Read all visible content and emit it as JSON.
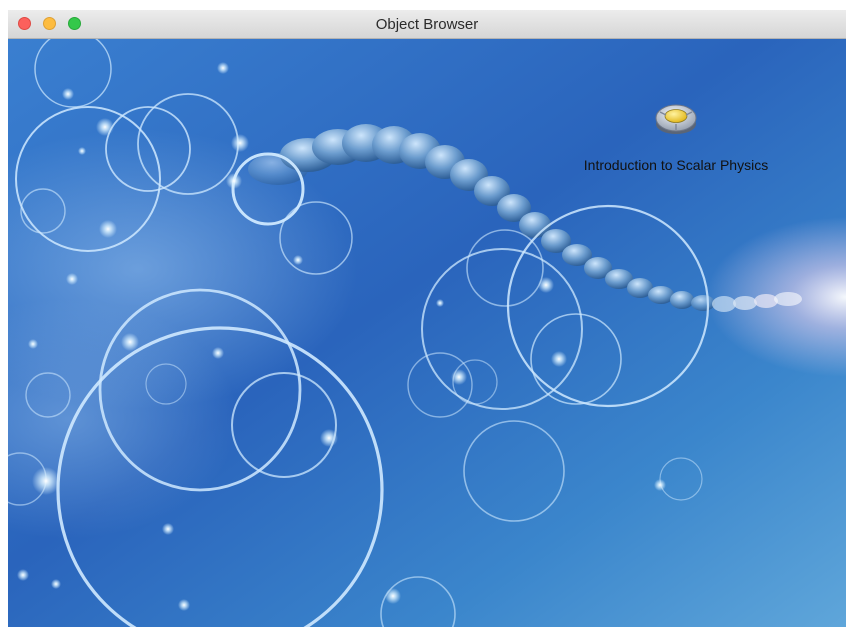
{
  "window": {
    "title": "Object Browser",
    "controls": [
      "close",
      "minimize",
      "zoom"
    ]
  },
  "desktop": {
    "items": [
      {
        "label": "Introduction to Scalar Physics",
        "icon": "scalar-object-icon"
      }
    ]
  },
  "colors": {
    "background_dark": "#1d56ad",
    "background_light": "#6fb0e2",
    "ring": "#cfe9ff",
    "icon_center": "#f2cc2c"
  }
}
